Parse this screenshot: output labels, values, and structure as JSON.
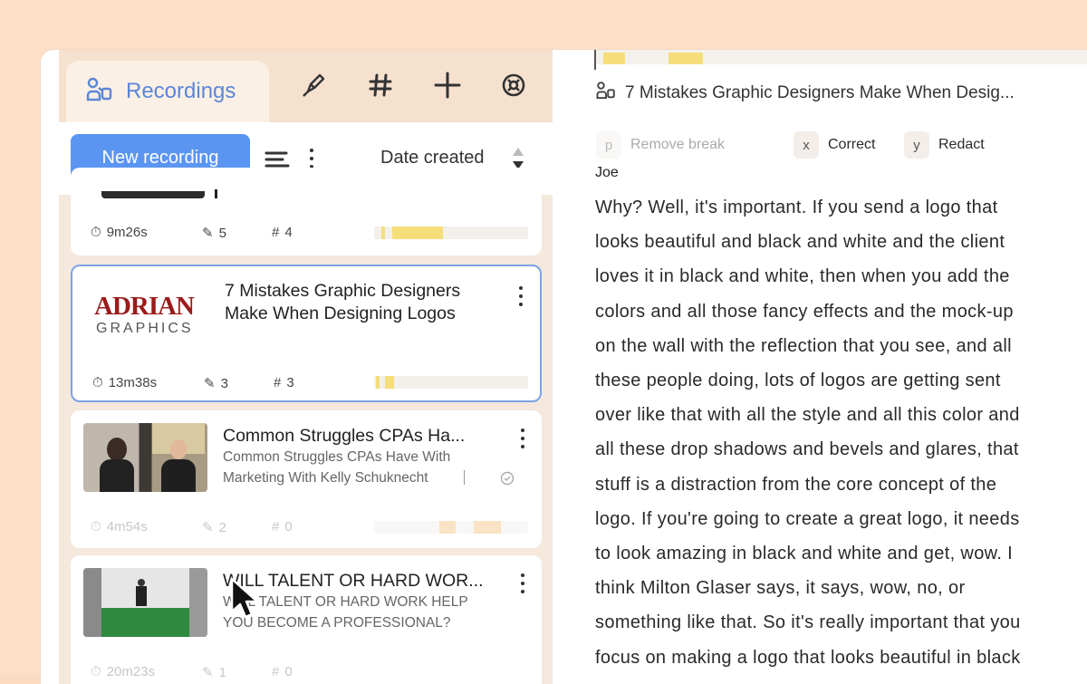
{
  "tabs": {
    "recordings_label": "Recordings"
  },
  "toolbar": {
    "new_recording_label": "New recording",
    "sort_label": "Date created"
  },
  "recordings": [
    {
      "title": "",
      "duration": "9m26s",
      "highlights": "5",
      "tags": "4",
      "progress": 0.23
    },
    {
      "title": "7 Mistakes Graphic Designers Make When Designing Logos",
      "title_line1": "7 Mistakes Graphic Designers",
      "title_line2": "Make When Designing Logos",
      "thumb_logo_line1": "ADRIAN",
      "thumb_logo_line2": "GRAPHICS",
      "duration": "13m38s",
      "highlights": "3",
      "tags": "3",
      "selected": true
    },
    {
      "title": "Common Struggles CPAs Ha...",
      "subtitle_line1": "Common Struggles CPAs Have With",
      "subtitle_line2": "Marketing With Kelly Schuknecht",
      "duration": "4m54s",
      "highlights": "2",
      "tags": "0"
    },
    {
      "title": "WILL TALENT OR HARD WOR...",
      "subtitle_line1": "WILL TALENT OR HARD WORK HELP",
      "subtitle_line2": "YOU BECOME A PROFESSIONAL?",
      "duration": "20m23s",
      "highlights": "1",
      "tags": "0"
    }
  ],
  "detail": {
    "title": "7 Mistakes Graphic Designers Make When Desig...",
    "actions": [
      {
        "key": "p",
        "label": "Remove break"
      },
      {
        "key": "x",
        "label": "Correct"
      },
      {
        "key": "y",
        "label": "Redact"
      }
    ],
    "speaker": "Joe",
    "transcript_lines": [
      "Why? Well, it's important. If you send a logo that",
      "looks beautiful and black and white and the client",
      "loves it in black and white, then when you add the",
      "colors and all those fancy effects and the mock-up",
      "on the wall with the reflection that you see, and all",
      "these people doing, lots of logos are getting sent",
      "over like that with all the style and all this color and",
      "all these drop shadows and bevels and glares, that",
      "stuff is a distraction from the core concept of the",
      "logo. If you're going to create a great logo, it needs",
      "to look amazing in black and white and get, wow. I",
      "think Milton Glaser says, it says, wow, no, or",
      "something like that. So it's really important that you",
      "focus on making a logo that looks beautiful in black"
    ]
  },
  "colors": {
    "accent": "#5b95f2",
    "tab_text": "#5b86d6",
    "highlight": "#f5de7a",
    "background": "#fde0c8"
  }
}
